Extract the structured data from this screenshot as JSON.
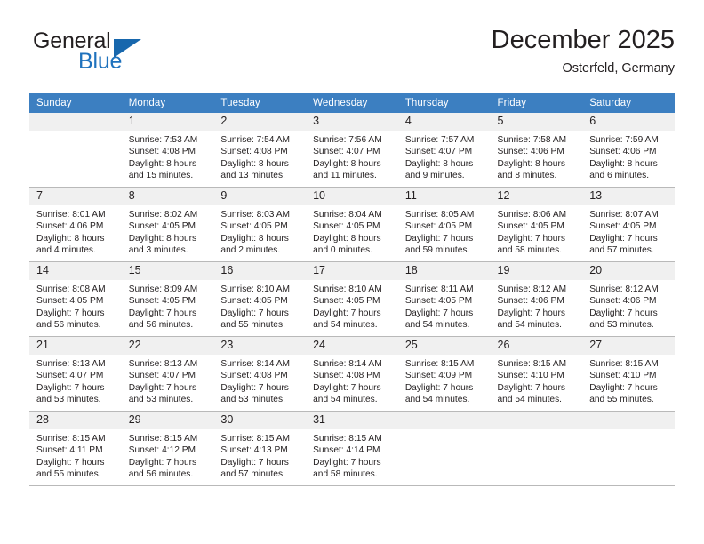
{
  "brand": {
    "name_part1": "General",
    "name_part2": "Blue",
    "accent_color": "#1767ad"
  },
  "header": {
    "title": "December 2025",
    "location": "Osterfeld, Germany"
  },
  "calendar": {
    "header_bg": "#3c7fc1",
    "daynum_bg": "#f0f0f0",
    "weekdays": [
      "Sunday",
      "Monday",
      "Tuesday",
      "Wednesday",
      "Thursday",
      "Friday",
      "Saturday"
    ],
    "weeks": [
      [
        {
          "day": "",
          "sunrise": "",
          "sunset": "",
          "daylight1": "",
          "daylight2": ""
        },
        {
          "day": "1",
          "sunrise": "Sunrise: 7:53 AM",
          "sunset": "Sunset: 4:08 PM",
          "daylight1": "Daylight: 8 hours",
          "daylight2": "and 15 minutes."
        },
        {
          "day": "2",
          "sunrise": "Sunrise: 7:54 AM",
          "sunset": "Sunset: 4:08 PM",
          "daylight1": "Daylight: 8 hours",
          "daylight2": "and 13 minutes."
        },
        {
          "day": "3",
          "sunrise": "Sunrise: 7:56 AM",
          "sunset": "Sunset: 4:07 PM",
          "daylight1": "Daylight: 8 hours",
          "daylight2": "and 11 minutes."
        },
        {
          "day": "4",
          "sunrise": "Sunrise: 7:57 AM",
          "sunset": "Sunset: 4:07 PM",
          "daylight1": "Daylight: 8 hours",
          "daylight2": "and 9 minutes."
        },
        {
          "day": "5",
          "sunrise": "Sunrise: 7:58 AM",
          "sunset": "Sunset: 4:06 PM",
          "daylight1": "Daylight: 8 hours",
          "daylight2": "and 8 minutes."
        },
        {
          "day": "6",
          "sunrise": "Sunrise: 7:59 AM",
          "sunset": "Sunset: 4:06 PM",
          "daylight1": "Daylight: 8 hours",
          "daylight2": "and 6 minutes."
        }
      ],
      [
        {
          "day": "7",
          "sunrise": "Sunrise: 8:01 AM",
          "sunset": "Sunset: 4:06 PM",
          "daylight1": "Daylight: 8 hours",
          "daylight2": "and 4 minutes."
        },
        {
          "day": "8",
          "sunrise": "Sunrise: 8:02 AM",
          "sunset": "Sunset: 4:05 PM",
          "daylight1": "Daylight: 8 hours",
          "daylight2": "and 3 minutes."
        },
        {
          "day": "9",
          "sunrise": "Sunrise: 8:03 AM",
          "sunset": "Sunset: 4:05 PM",
          "daylight1": "Daylight: 8 hours",
          "daylight2": "and 2 minutes."
        },
        {
          "day": "10",
          "sunrise": "Sunrise: 8:04 AM",
          "sunset": "Sunset: 4:05 PM",
          "daylight1": "Daylight: 8 hours",
          "daylight2": "and 0 minutes."
        },
        {
          "day": "11",
          "sunrise": "Sunrise: 8:05 AM",
          "sunset": "Sunset: 4:05 PM",
          "daylight1": "Daylight: 7 hours",
          "daylight2": "and 59 minutes."
        },
        {
          "day": "12",
          "sunrise": "Sunrise: 8:06 AM",
          "sunset": "Sunset: 4:05 PM",
          "daylight1": "Daylight: 7 hours",
          "daylight2": "and 58 minutes."
        },
        {
          "day": "13",
          "sunrise": "Sunrise: 8:07 AM",
          "sunset": "Sunset: 4:05 PM",
          "daylight1": "Daylight: 7 hours",
          "daylight2": "and 57 minutes."
        }
      ],
      [
        {
          "day": "14",
          "sunrise": "Sunrise: 8:08 AM",
          "sunset": "Sunset: 4:05 PM",
          "daylight1": "Daylight: 7 hours",
          "daylight2": "and 56 minutes."
        },
        {
          "day": "15",
          "sunrise": "Sunrise: 8:09 AM",
          "sunset": "Sunset: 4:05 PM",
          "daylight1": "Daylight: 7 hours",
          "daylight2": "and 56 minutes."
        },
        {
          "day": "16",
          "sunrise": "Sunrise: 8:10 AM",
          "sunset": "Sunset: 4:05 PM",
          "daylight1": "Daylight: 7 hours",
          "daylight2": "and 55 minutes."
        },
        {
          "day": "17",
          "sunrise": "Sunrise: 8:10 AM",
          "sunset": "Sunset: 4:05 PM",
          "daylight1": "Daylight: 7 hours",
          "daylight2": "and 54 minutes."
        },
        {
          "day": "18",
          "sunrise": "Sunrise: 8:11 AM",
          "sunset": "Sunset: 4:05 PM",
          "daylight1": "Daylight: 7 hours",
          "daylight2": "and 54 minutes."
        },
        {
          "day": "19",
          "sunrise": "Sunrise: 8:12 AM",
          "sunset": "Sunset: 4:06 PM",
          "daylight1": "Daylight: 7 hours",
          "daylight2": "and 54 minutes."
        },
        {
          "day": "20",
          "sunrise": "Sunrise: 8:12 AM",
          "sunset": "Sunset: 4:06 PM",
          "daylight1": "Daylight: 7 hours",
          "daylight2": "and 53 minutes."
        }
      ],
      [
        {
          "day": "21",
          "sunrise": "Sunrise: 8:13 AM",
          "sunset": "Sunset: 4:07 PM",
          "daylight1": "Daylight: 7 hours",
          "daylight2": "and 53 minutes."
        },
        {
          "day": "22",
          "sunrise": "Sunrise: 8:13 AM",
          "sunset": "Sunset: 4:07 PM",
          "daylight1": "Daylight: 7 hours",
          "daylight2": "and 53 minutes."
        },
        {
          "day": "23",
          "sunrise": "Sunrise: 8:14 AM",
          "sunset": "Sunset: 4:08 PM",
          "daylight1": "Daylight: 7 hours",
          "daylight2": "and 53 minutes."
        },
        {
          "day": "24",
          "sunrise": "Sunrise: 8:14 AM",
          "sunset": "Sunset: 4:08 PM",
          "daylight1": "Daylight: 7 hours",
          "daylight2": "and 54 minutes."
        },
        {
          "day": "25",
          "sunrise": "Sunrise: 8:15 AM",
          "sunset": "Sunset: 4:09 PM",
          "daylight1": "Daylight: 7 hours",
          "daylight2": "and 54 minutes."
        },
        {
          "day": "26",
          "sunrise": "Sunrise: 8:15 AM",
          "sunset": "Sunset: 4:10 PM",
          "daylight1": "Daylight: 7 hours",
          "daylight2": "and 54 minutes."
        },
        {
          "day": "27",
          "sunrise": "Sunrise: 8:15 AM",
          "sunset": "Sunset: 4:10 PM",
          "daylight1": "Daylight: 7 hours",
          "daylight2": "and 55 minutes."
        }
      ],
      [
        {
          "day": "28",
          "sunrise": "Sunrise: 8:15 AM",
          "sunset": "Sunset: 4:11 PM",
          "daylight1": "Daylight: 7 hours",
          "daylight2": "and 55 minutes."
        },
        {
          "day": "29",
          "sunrise": "Sunrise: 8:15 AM",
          "sunset": "Sunset: 4:12 PM",
          "daylight1": "Daylight: 7 hours",
          "daylight2": "and 56 minutes."
        },
        {
          "day": "30",
          "sunrise": "Sunrise: 8:15 AM",
          "sunset": "Sunset: 4:13 PM",
          "daylight1": "Daylight: 7 hours",
          "daylight2": "and 57 minutes."
        },
        {
          "day": "31",
          "sunrise": "Sunrise: 8:15 AM",
          "sunset": "Sunset: 4:14 PM",
          "daylight1": "Daylight: 7 hours",
          "daylight2": "and 58 minutes."
        },
        {
          "day": "",
          "sunrise": "",
          "sunset": "",
          "daylight1": "",
          "daylight2": ""
        },
        {
          "day": "",
          "sunrise": "",
          "sunset": "",
          "daylight1": "",
          "daylight2": ""
        },
        {
          "day": "",
          "sunrise": "",
          "sunset": "",
          "daylight1": "",
          "daylight2": ""
        }
      ]
    ]
  }
}
